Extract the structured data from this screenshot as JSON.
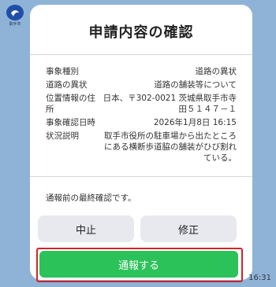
{
  "header": {
    "logo_text": "取手市"
  },
  "dialog": {
    "title": "申請内容の確認",
    "details": [
      {
        "label": "事象種別",
        "value": "道路の異状"
      },
      {
        "label": "道路の異状",
        "value": "道路の舗装等について"
      },
      {
        "label": "位置情報の住所",
        "value": "日本、〒302-0021 茨城県取手市寺田５１４７－１"
      },
      {
        "label": "事象確認日時",
        "value": "2026年1月8日 16:15"
      },
      {
        "label": "状況説明",
        "value": "取手市役所の駐車場から出たところにある横断歩道脇の舗装がひび割れている。"
      }
    ],
    "final_note": "通報前の最終確認です。",
    "cancel_label": "中止",
    "fix_label": "修正",
    "send_label": "通報する"
  },
  "message_time": "16:31",
  "colors": {
    "background": "#8fb3d6",
    "send_button": "#2cc25a",
    "highlight_border": "#d2232a",
    "secondary_button": "#e7e9ef"
  }
}
